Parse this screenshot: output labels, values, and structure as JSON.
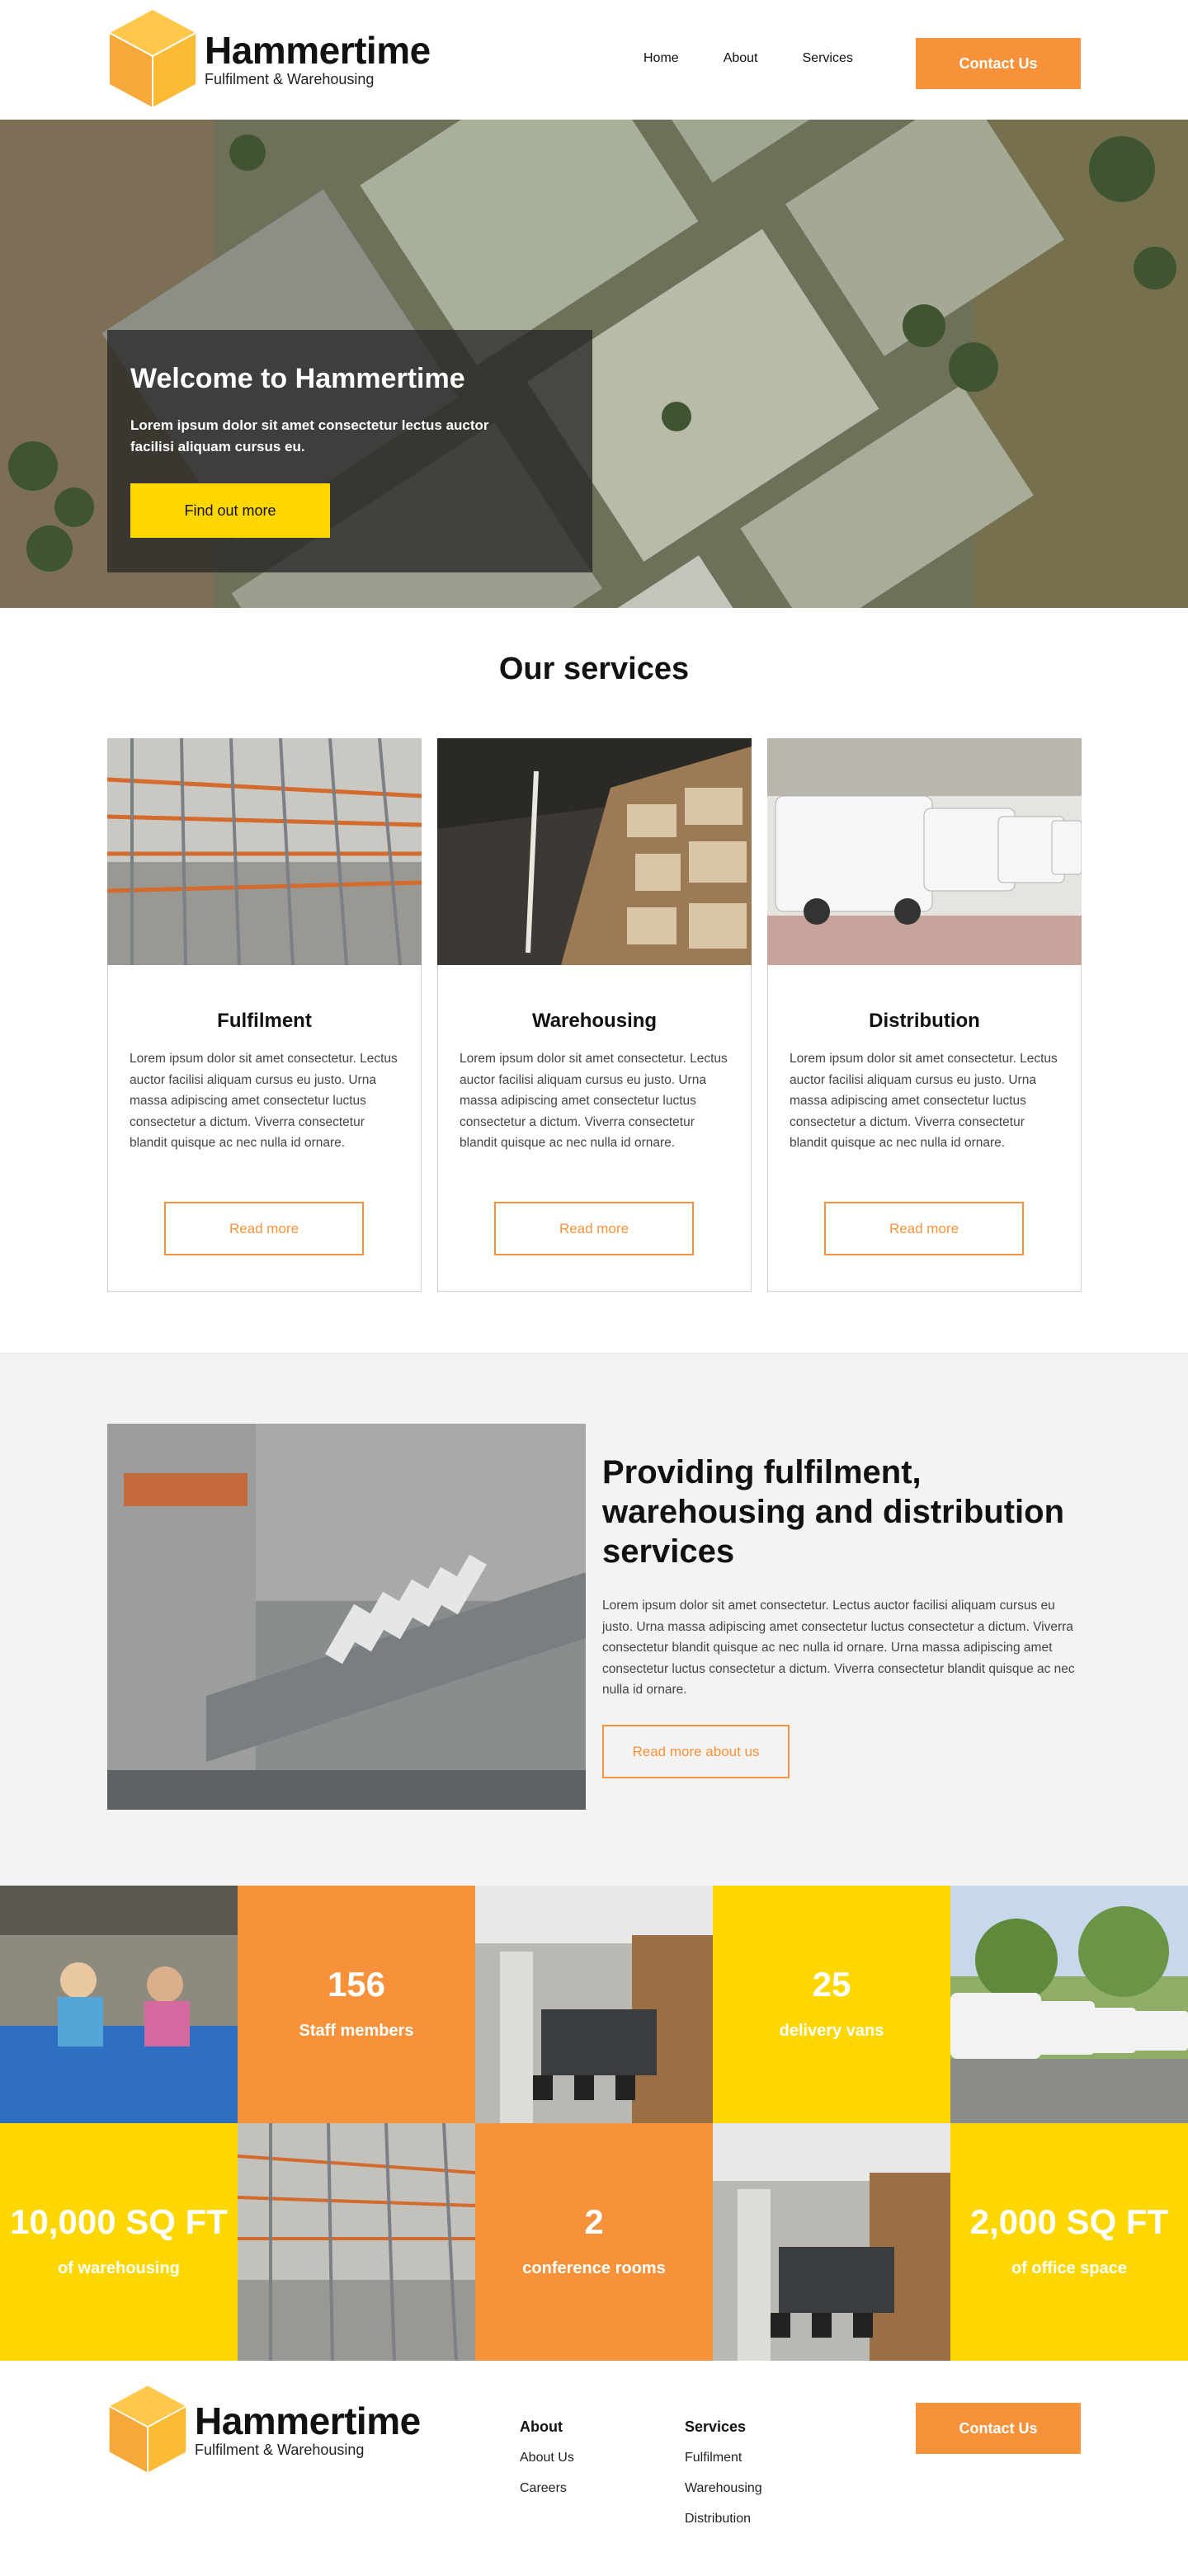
{
  "colors": {
    "accent_orange": "#f7923a",
    "accent_yellow": "#ffd700",
    "text": "#111111",
    "panel_gray": "#f3f3f3"
  },
  "brand": {
    "name": "Hammertime",
    "tagline": "Fulfilment & Warehousing",
    "logo_icon": "cube-icon"
  },
  "nav": {
    "items": [
      {
        "label": "Home"
      },
      {
        "label": "About"
      },
      {
        "label": "Services"
      }
    ],
    "contact_label": "Contact Us"
  },
  "hero": {
    "title": "Welcome to Hammertime",
    "subtitle": "Lorem ipsum dolor sit amet consectetur lectus auctor facilisi aliquam cursus eu.",
    "button_label": "Find out more",
    "image": "aerial-warehouse-estate-photo"
  },
  "services": {
    "heading": "Our services",
    "cards": [
      {
        "title": "Fulfilment",
        "text": "Lorem ipsum dolor sit amet consectetur. Lectus auctor facilisi aliquam cursus eu justo. Urna massa adipiscing amet consectetur luctus consectetur a dictum. Viverra consectetur blandit quisque ac nec nulla id ornare.",
        "button_label": "Read more",
        "image": "pallet-racking-photo"
      },
      {
        "title": "Warehousing",
        "text": "Lorem ipsum dolor sit amet consectetur. Lectus auctor facilisi aliquam cursus eu justo. Urna massa adipiscing amet consectetur luctus consectetur a dictum. Viverra consectetur blandit quisque ac nec nulla id ornare.",
        "button_label": "Read more",
        "image": "warehouse-shelves-photo"
      },
      {
        "title": "Distribution",
        "text": "Lorem ipsum dolor sit amet consectetur. Lectus auctor facilisi aliquam cursus eu justo. Urna massa adipiscing amet consectetur luctus consectetur a dictum. Viverra consectetur blandit quisque ac nec nulla id ornare.",
        "button_label": "Read more",
        "image": "delivery-vans-photo"
      }
    ]
  },
  "about": {
    "title": "Providing fulfilment, warehousing and distribution services",
    "text": "Lorem ipsum dolor sit amet consectetur. Lectus auctor facilisi aliquam cursus eu justo. Urna massa adipiscing amet consectetur luctus consectetur a dictum. Viverra consectetur blandit quisque ac nec nulla id ornare. Urna massa adipiscing amet consectetur luctus consectetur a dictum. Viverra consectetur blandit quisque ac nec nulla id ornare.",
    "button_label": "Read more about us",
    "image": "aerial-loading-bay-photo"
  },
  "stats": [
    {
      "number": "156",
      "label": "Staff members"
    },
    {
      "number": "25",
      "label": "delivery vans"
    },
    {
      "number": "10,000 SQ FT",
      "label": "of warehousing"
    },
    {
      "number": "2",
      "label": "conference rooms"
    },
    {
      "number": "2,000 SQ FT",
      "label": "of office space"
    }
  ],
  "footer": {
    "about_heading": "About",
    "about_links": [
      {
        "label": "About Us"
      },
      {
        "label": "Careers"
      }
    ],
    "services_heading": "Services",
    "services_links": [
      {
        "label": "Fulfilment"
      },
      {
        "label": "Warehousing"
      },
      {
        "label": "Distribution"
      }
    ],
    "contact_label": "Contact Us"
  }
}
